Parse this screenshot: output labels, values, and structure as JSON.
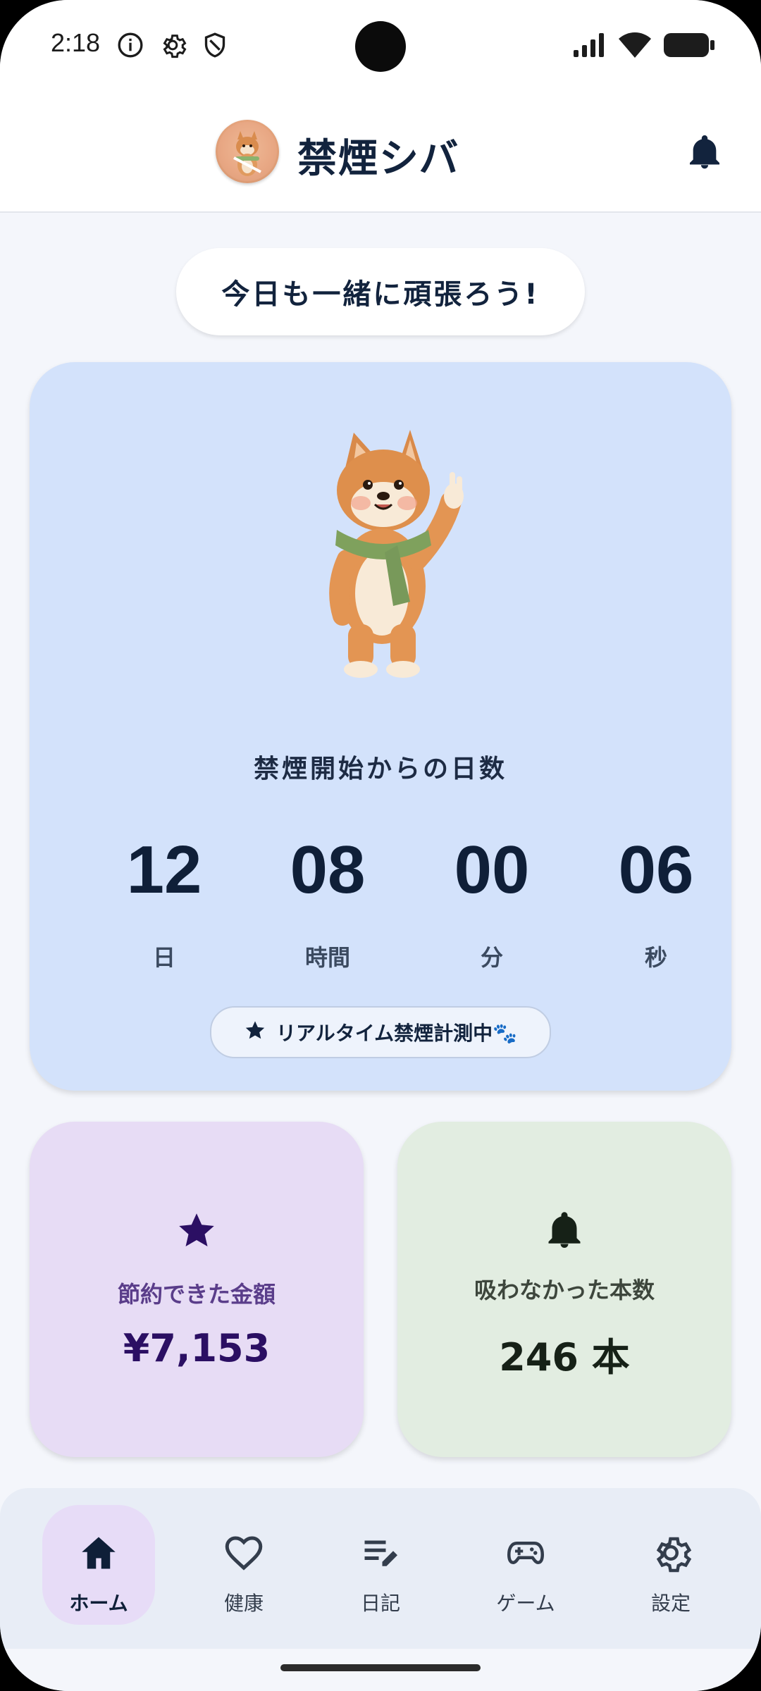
{
  "status": {
    "time": "2:18",
    "icons_left": [
      "info-icon",
      "gear-icon",
      "shield-icon"
    ],
    "icons_right": [
      "signal-icon",
      "wifi-icon",
      "battery-icon"
    ]
  },
  "app": {
    "title": "禁煙シバ",
    "avatar": "shiba-avatar"
  },
  "encouragement": "今日も一緒に頑張ろう!",
  "timer": {
    "label": "禁煙開始からの日数",
    "days": "12",
    "days_unit": "日",
    "hours": "08",
    "hours_unit": "時間",
    "minutes": "00",
    "minutes_unit": "分",
    "seconds": "06",
    "seconds_unit": "秒",
    "live_label": "リアルタイム禁煙計測中🐾"
  },
  "stats": {
    "saved_label": "節約できた金額",
    "saved_value": "¥7,153",
    "not_smoked_label": "吸わなかった本数",
    "not_smoked_value": "246 本"
  },
  "nav": [
    {
      "label": "ホーム",
      "icon": "home-icon",
      "active": true
    },
    {
      "label": "健康",
      "icon": "heart-icon",
      "active": false
    },
    {
      "label": "日記",
      "icon": "edit-note-icon",
      "active": false
    },
    {
      "label": "ゲーム",
      "icon": "gamepad-icon",
      "active": false
    },
    {
      "label": "設定",
      "icon": "gear-icon",
      "active": false
    }
  ],
  "colors": {
    "primary_text": "#12233d",
    "card_blue": "#d3e2fb",
    "card_purple": "#e7dcf5",
    "card_green": "#e2ede1",
    "accent_purple": "#2b0f63",
    "nav_active": "#e7dcf7"
  }
}
